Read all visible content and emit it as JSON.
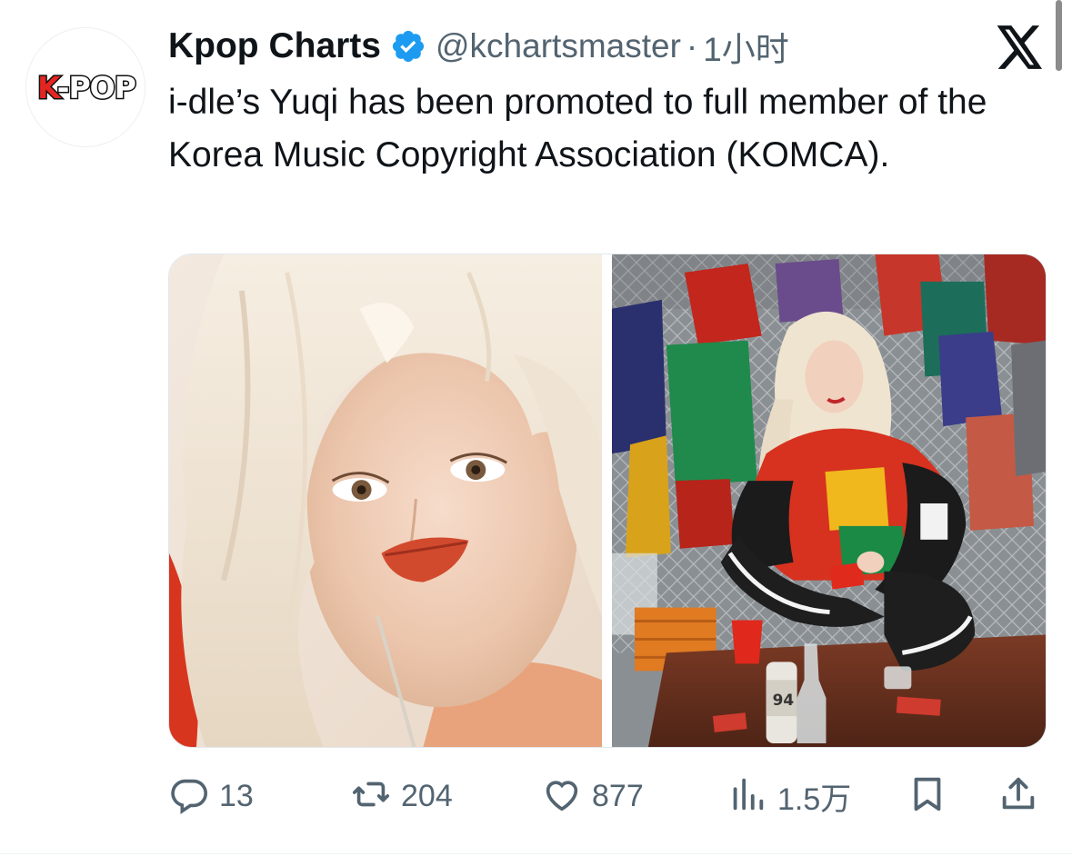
{
  "avatar": {
    "logo_k": "K",
    "logo_rest": "-POP"
  },
  "author": {
    "display_name": "Kpop Charts",
    "handle": "@kchartsmaster",
    "separator": "·",
    "time": "1小时",
    "verified": true
  },
  "tweet": {
    "text": "i-dle’s Yuqi has been promoted to full member of the Korea Music Copyright Association (KOMCA).",
    "media_count": 2
  },
  "actions": {
    "replies": "13",
    "retweets": "204",
    "likes": "877",
    "views": "1.5万"
  },
  "icons": {
    "verified": "verified-badge-icon",
    "logo": "x-logo-icon",
    "reply": "reply-icon",
    "retweet": "retweet-icon",
    "like": "heart-icon",
    "views": "views-chart-icon",
    "bookmark": "bookmark-icon",
    "share": "share-icon"
  },
  "colors": {
    "verified_blue": "#1d9bf0",
    "secondary_text": "#536471",
    "primary_text": "#0f1419"
  }
}
